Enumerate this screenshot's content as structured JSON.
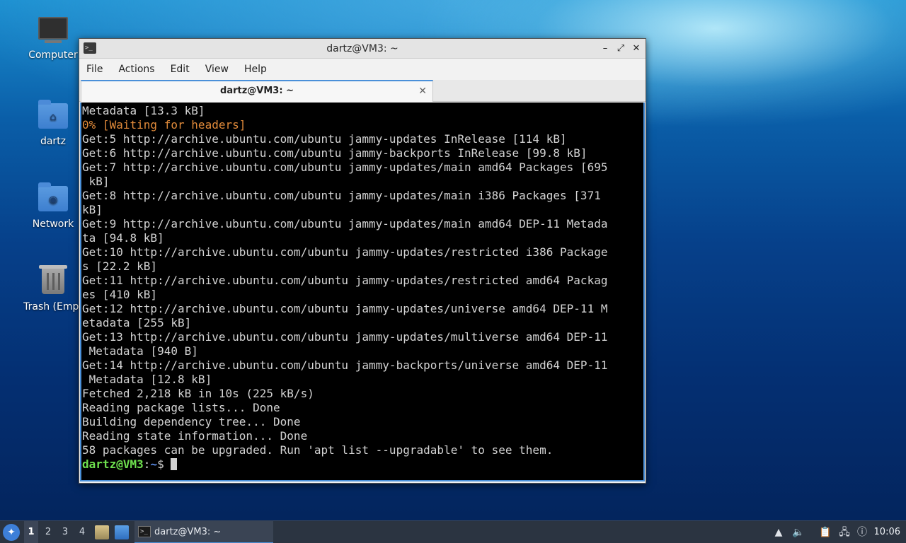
{
  "desktop": {
    "icons": [
      {
        "label": "Computer"
      },
      {
        "label": "dartz"
      },
      {
        "label": "Network"
      },
      {
        "label": "Trash (Empt"
      }
    ]
  },
  "window": {
    "title": "dartz@VM3: ~",
    "menu": [
      "File",
      "Actions",
      "Edit",
      "View",
      "Help"
    ],
    "tab": {
      "label": "dartz@VM3: ~",
      "close": "✕"
    },
    "terminal": {
      "lines": [
        "Metadata [13.3 kB]",
        "0% [Waiting for headers]",
        "Get:5 http://archive.ubuntu.com/ubuntu jammy-updates InRelease [114 kB]",
        "Get:6 http://archive.ubuntu.com/ubuntu jammy-backports InRelease [99.8 kB]",
        "Get:7 http://archive.ubuntu.com/ubuntu jammy-updates/main amd64 Packages [695",
        " kB]",
        "Get:8 http://archive.ubuntu.com/ubuntu jammy-updates/main i386 Packages [371",
        "kB]",
        "Get:9 http://archive.ubuntu.com/ubuntu jammy-updates/main amd64 DEP-11 Metada",
        "ta [94.8 kB]",
        "Get:10 http://archive.ubuntu.com/ubuntu jammy-updates/restricted i386 Package",
        "s [22.2 kB]",
        "Get:11 http://archive.ubuntu.com/ubuntu jammy-updates/restricted amd64 Packag",
        "es [410 kB]",
        "Get:12 http://archive.ubuntu.com/ubuntu jammy-updates/universe amd64 DEP-11 M",
        "etadata [255 kB]",
        "Get:13 http://archive.ubuntu.com/ubuntu jammy-updates/multiverse amd64 DEP-11",
        " Metadata [940 B]",
        "Get:14 http://archive.ubuntu.com/ubuntu jammy-backports/universe amd64 DEP-11",
        " Metadata [12.8 kB]",
        "Fetched 2,218 kB in 10s (225 kB/s)",
        "Reading package lists... Done",
        "Building dependency tree... Done",
        "Reading state information... Done",
        "58 packages can be upgraded. Run 'apt list --upgradable' to see them."
      ],
      "prompt": {
        "user": "dartz@VM3",
        "sep": ":",
        "path": "~",
        "symbol": "$ "
      }
    }
  },
  "taskbar": {
    "workspaces": [
      "1",
      "2",
      "3",
      "4"
    ],
    "active_task": "dartz@VM3: ~",
    "clock": "10:06"
  },
  "colors": {
    "accent": "#4a90d9",
    "prompt_user": "#6ee04e",
    "prompt_path": "#5b8de8",
    "warning_text": "#e08a3a"
  }
}
